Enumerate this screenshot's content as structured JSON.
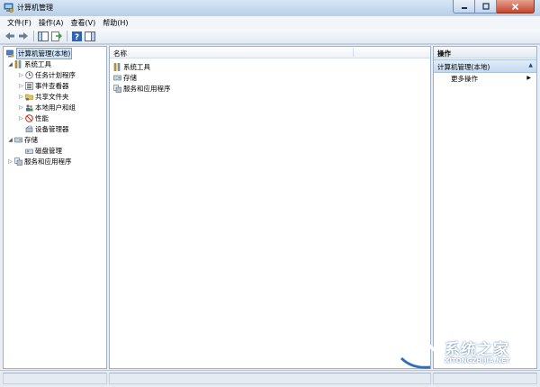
{
  "window": {
    "title": "计算机管理"
  },
  "menu": [
    "文件(F)",
    "操作(A)",
    "查看(V)",
    "帮助(H)"
  ],
  "tree": {
    "root": "计算机管理(本地)",
    "system_tools": "系统工具",
    "task_scheduler": "任务计划程序",
    "event_viewer": "事件查看器",
    "shared_folders": "共享文件夹",
    "local_users_groups": "本地用户和组",
    "performance": "性能",
    "device_manager": "设备管理器",
    "storage": "存储",
    "disk_management": "磁盘管理",
    "services_apps": "服务和应用程序"
  },
  "list": {
    "column_name": "名称",
    "items": [
      "系统工具",
      "存储",
      "服务和应用程序"
    ]
  },
  "actions": {
    "header": "操作",
    "section": "计算机管理(本地)",
    "more": "更多操作"
  },
  "watermark": {
    "text": "系统之家",
    "url": "XITONGZHIJIA.NET"
  },
  "colors": {
    "title_bar": "#c8dbef",
    "selection": "#cde3f7",
    "close_button": "#c4452e",
    "frame": "#bcd1e8"
  }
}
